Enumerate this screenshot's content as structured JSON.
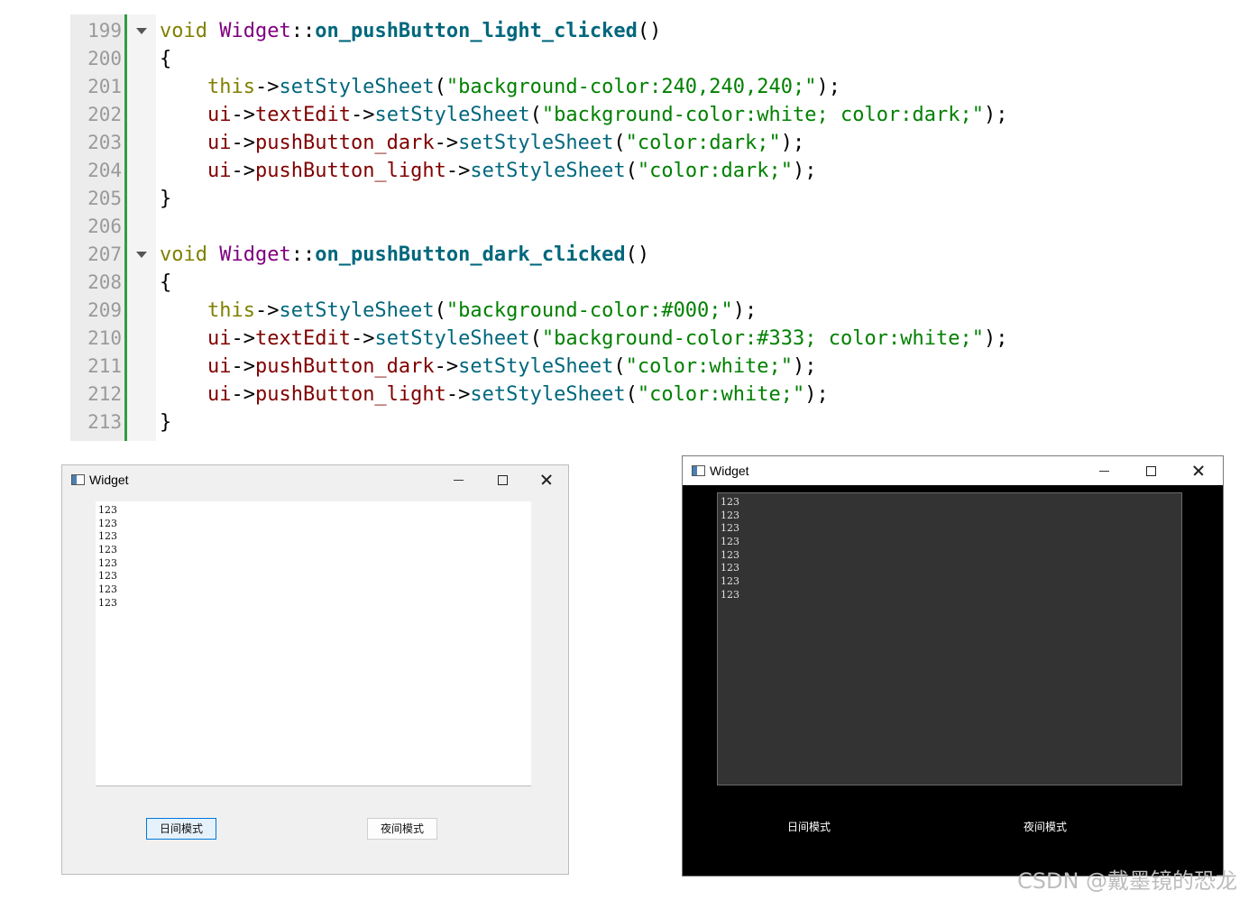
{
  "editor": {
    "lines": [
      {
        "n": "199",
        "fold": true,
        "tokens": [
          [
            "k",
            "void"
          ],
          [
            "",
            ""
          ],
          [
            "cls",
            "Widget"
          ],
          [
            "",
            "::"
          ],
          [
            "fn",
            "on_pushButton_light_clicked"
          ],
          [
            "",
            "()"
          ]
        ]
      },
      {
        "n": "200",
        "fold": false,
        "tokens": [
          [
            "",
            "{"
          ]
        ]
      },
      {
        "n": "201",
        "fold": false,
        "tokens": [
          [
            "",
            "    "
          ],
          [
            "kw",
            "this"
          ],
          [
            "",
            "->"
          ],
          [
            "call",
            "setStyleSheet"
          ],
          [
            "",
            "("
          ],
          [
            "str",
            "\"background-color:240,240,240;\""
          ],
          [
            "",
            ");"
          ]
        ]
      },
      {
        "n": "202",
        "fold": false,
        "tokens": [
          [
            "",
            "    "
          ],
          [
            "mem",
            "ui"
          ],
          [
            "",
            "->"
          ],
          [
            "mem",
            "textEdit"
          ],
          [
            "",
            "->"
          ],
          [
            "call",
            "setStyleSheet"
          ],
          [
            "",
            "("
          ],
          [
            "str",
            "\"background-color:white; color:dark;\""
          ],
          [
            "",
            ");"
          ]
        ]
      },
      {
        "n": "203",
        "fold": false,
        "tokens": [
          [
            "",
            "    "
          ],
          [
            "mem",
            "ui"
          ],
          [
            "",
            "->"
          ],
          [
            "mem",
            "pushButton_dark"
          ],
          [
            "",
            "->"
          ],
          [
            "call",
            "setStyleSheet"
          ],
          [
            "",
            "("
          ],
          [
            "str",
            "\"color:dark;\""
          ],
          [
            "",
            ");"
          ]
        ]
      },
      {
        "n": "204",
        "fold": false,
        "tokens": [
          [
            "",
            "    "
          ],
          [
            "mem",
            "ui"
          ],
          [
            "",
            "->"
          ],
          [
            "mem",
            "pushButton_light"
          ],
          [
            "",
            "->"
          ],
          [
            "call",
            "setStyleSheet"
          ],
          [
            "",
            "("
          ],
          [
            "str",
            "\"color:dark;\""
          ],
          [
            "",
            ");"
          ]
        ]
      },
      {
        "n": "205",
        "fold": false,
        "tokens": [
          [
            "",
            "}"
          ]
        ]
      },
      {
        "n": "206",
        "fold": false,
        "tokens": []
      },
      {
        "n": "207",
        "fold": true,
        "tokens": [
          [
            "k",
            "void"
          ],
          [
            "",
            ""
          ],
          [
            "cls",
            "Widget"
          ],
          [
            "",
            "::"
          ],
          [
            "fn",
            "on_pushButton_dark_clicked"
          ],
          [
            "",
            "()"
          ]
        ]
      },
      {
        "n": "208",
        "fold": false,
        "tokens": [
          [
            "",
            "{"
          ]
        ]
      },
      {
        "n": "209",
        "fold": false,
        "tokens": [
          [
            "",
            "    "
          ],
          [
            "kw",
            "this"
          ],
          [
            "",
            "->"
          ],
          [
            "call",
            "setStyleSheet"
          ],
          [
            "",
            "("
          ],
          [
            "str",
            "\"background-color:#000;\""
          ],
          [
            "",
            ");"
          ]
        ]
      },
      {
        "n": "210",
        "fold": false,
        "tokens": [
          [
            "",
            "    "
          ],
          [
            "mem",
            "ui"
          ],
          [
            "",
            "->"
          ],
          [
            "mem",
            "textEdit"
          ],
          [
            "",
            "->"
          ],
          [
            "call",
            "setStyleSheet"
          ],
          [
            "",
            "("
          ],
          [
            "str",
            "\"background-color:#333; color:white;\""
          ],
          [
            "",
            ");"
          ]
        ]
      },
      {
        "n": "211",
        "fold": false,
        "tokens": [
          [
            "",
            "    "
          ],
          [
            "mem",
            "ui"
          ],
          [
            "",
            "->"
          ],
          [
            "mem",
            "pushButton_dark"
          ],
          [
            "",
            "->"
          ],
          [
            "call",
            "setStyleSheet"
          ],
          [
            "",
            "("
          ],
          [
            "str",
            "\"color:white;\""
          ],
          [
            "",
            ");"
          ]
        ]
      },
      {
        "n": "212",
        "fold": false,
        "tokens": [
          [
            "",
            "    "
          ],
          [
            "mem",
            "ui"
          ],
          [
            "",
            "->"
          ],
          [
            "mem",
            "pushButton_light"
          ],
          [
            "",
            "->"
          ],
          [
            "call",
            "setStyleSheet"
          ],
          [
            "",
            "("
          ],
          [
            "str",
            "\"color:white;\""
          ],
          [
            "",
            ");"
          ]
        ]
      },
      {
        "n": "213",
        "fold": false,
        "tokens": [
          [
            "",
            "}"
          ]
        ]
      }
    ]
  },
  "light_window": {
    "title": "Widget",
    "text_lines": [
      "123",
      "123",
      "123",
      "123",
      "123",
      "123",
      "123",
      "123"
    ],
    "day_button": "日间模式",
    "night_button": "夜间模式"
  },
  "dark_window": {
    "title": "Widget",
    "text_lines": [
      "123",
      "123",
      "123",
      "123",
      "123",
      "123",
      "123",
      "123"
    ],
    "day_button": "日间模式",
    "night_button": "夜间模式"
  },
  "watermark": "CSDN @戴墨镜的恐龙",
  "colors": {
    "gutter_marker": "#2f9e44",
    "light_bg": "#f0f0f0",
    "dark_bg": "#000000",
    "dark_textedit": "#333333",
    "focus_border": "#0078d7"
  }
}
